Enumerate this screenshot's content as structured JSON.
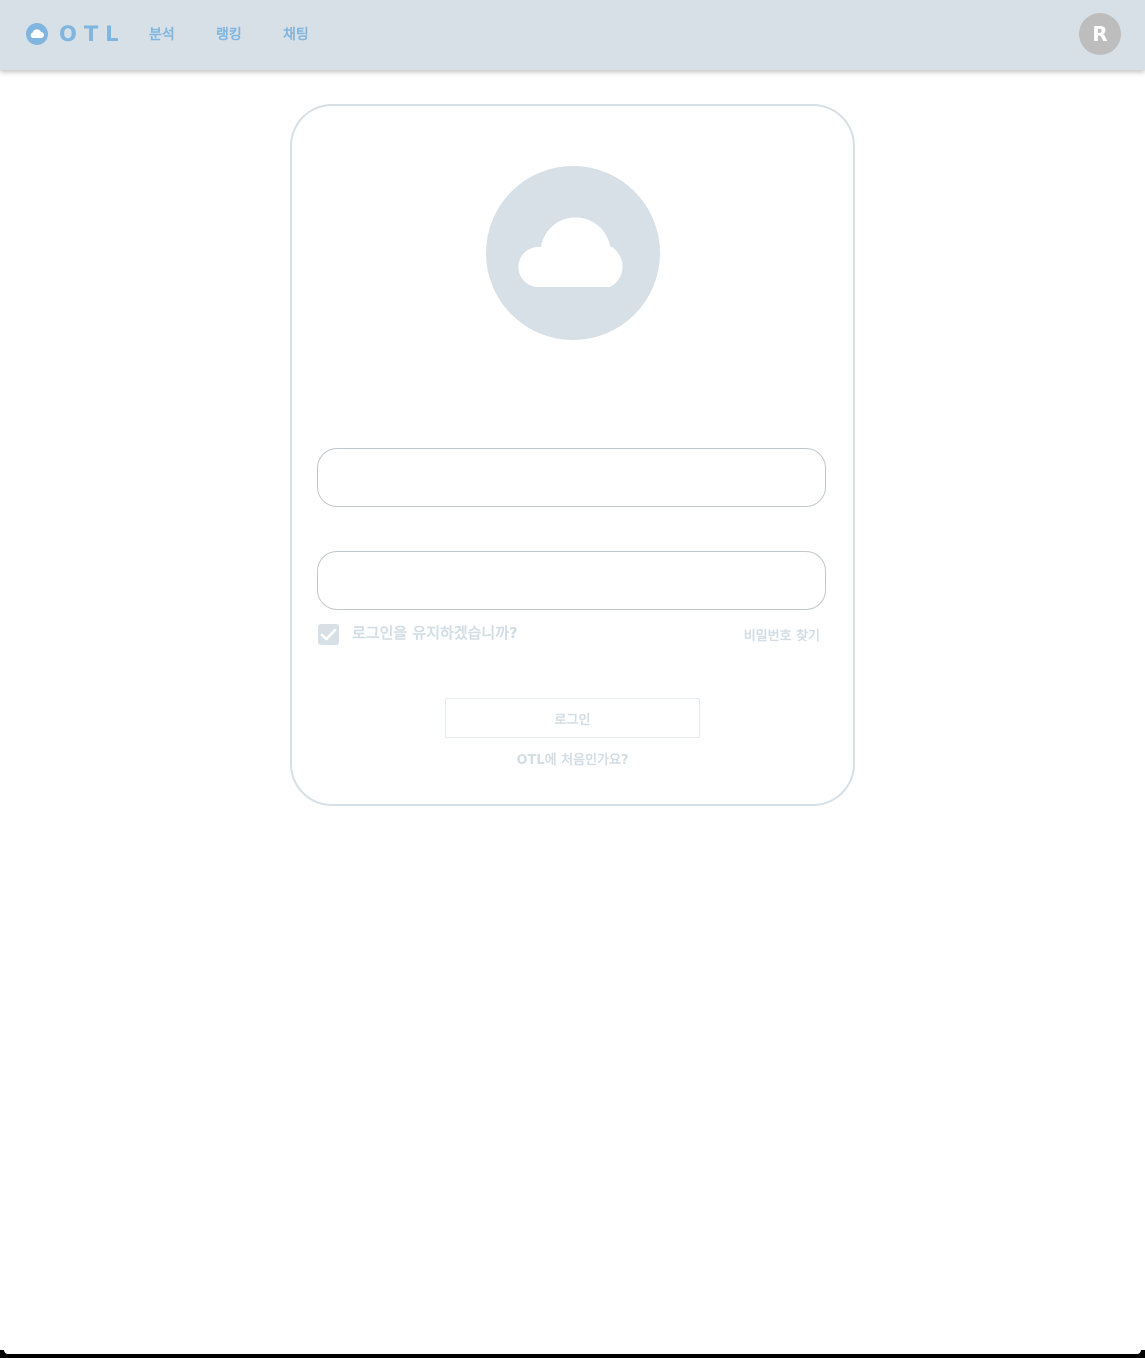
{
  "navbar": {
    "logo_text": "OTL",
    "logo_icon": "cloud-icon",
    "links": [
      "분석",
      "랭킹",
      "채팅"
    ],
    "avatar_letter": "R",
    "background_color": "#d7e0e6",
    "accent_color": "#7fb5de"
  },
  "login": {
    "hero_icon": "cloud-icon",
    "username": {
      "value": "",
      "placeholder": ""
    },
    "password": {
      "value": "",
      "placeholder": ""
    },
    "remember_checked": true,
    "remember_label": "로그인을 유지하겠습니까?",
    "find_password": "비밀번호 찾기",
    "submit_label": "로그인",
    "signup_link": "OTL에 처음인가요?",
    "muted_text_color": "#d2dde4"
  }
}
